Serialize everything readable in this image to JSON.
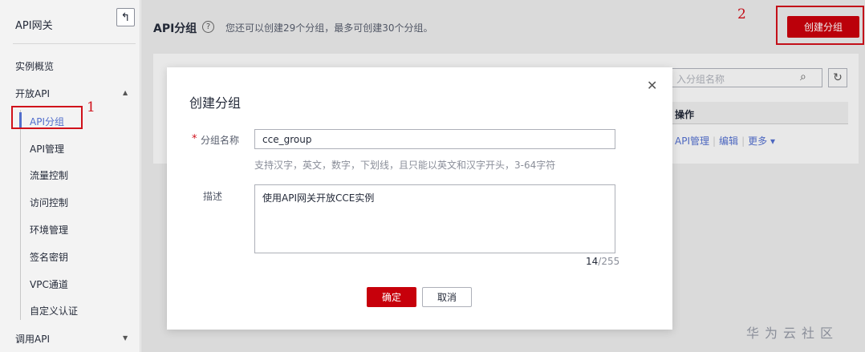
{
  "sidebar": {
    "title": "API网关",
    "back_icon": "↰",
    "items": [
      {
        "label": "实例概览"
      },
      {
        "label": "开放API"
      },
      {
        "label": "调用API"
      }
    ],
    "open_api_children": [
      {
        "label": "API分组"
      },
      {
        "label": "API管理"
      },
      {
        "label": "流量控制"
      },
      {
        "label": "访问控制"
      },
      {
        "label": "环境管理"
      },
      {
        "label": "签名密钥"
      },
      {
        "label": "VPC通道"
      },
      {
        "label": "自定义认证"
      }
    ]
  },
  "annotations": {
    "one": "1",
    "two": "2"
  },
  "page": {
    "title": "API分组",
    "hint": "您还可以创建29个分组，最多可创建30个分组。",
    "create_button": "创建分组",
    "search_placeholder": "入分组名称",
    "table_header_action": "操作",
    "row_actions": [
      "API管理",
      "编辑",
      "更多"
    ]
  },
  "modal": {
    "title": "创建分组",
    "name_label": "分组名称",
    "name_value": "cce_group",
    "name_hint": "支持汉字，英文，数字，下划线，且只能以英文和汉字开头，3-64字符",
    "desc_label": "描述",
    "desc_value": "使用API网关开放CCE实例",
    "count_current": "14",
    "count_max": "/255",
    "ok": "确定",
    "cancel": "取消"
  },
  "watermark": "华为云社区",
  "colors": {
    "brand_red": "#c7000b",
    "link_blue": "#526ecc",
    "annotation_red": "#d0111b"
  }
}
